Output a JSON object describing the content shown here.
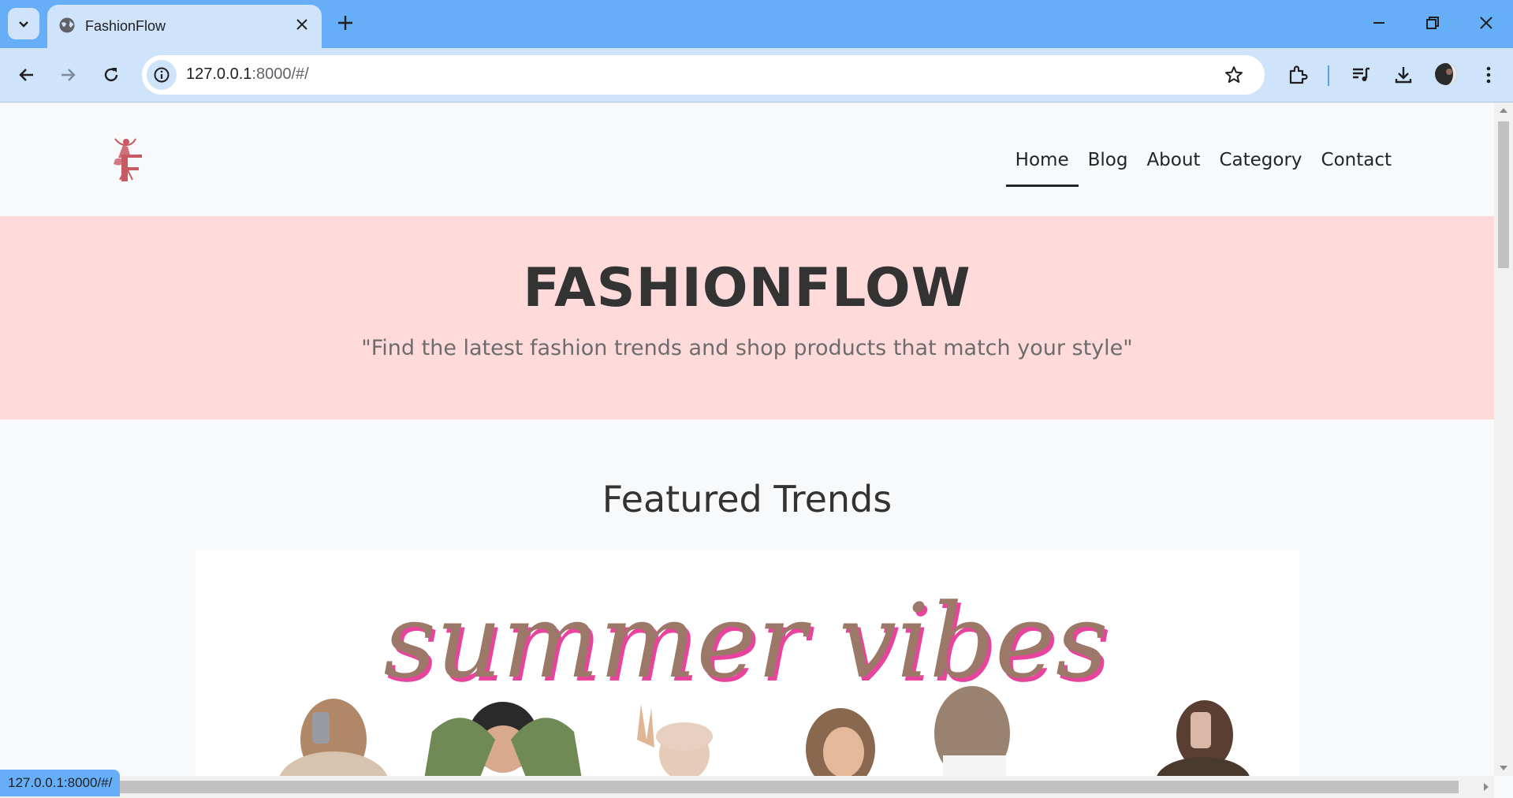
{
  "browser": {
    "tab_title": "FashionFlow",
    "url_host": "127.0.0.1",
    "url_path": ":8000/#/",
    "status_url": "127.0.0.1:8000/#/"
  },
  "site": {
    "logo_text": "FASHIONFLOW",
    "nav": [
      "Home",
      "Blog",
      "About",
      "Category",
      "Contact"
    ],
    "active_nav": "Home",
    "hero_title": "FASHIONFLOW",
    "hero_tagline": "\"Find the latest fashion trends and shop products that match your style\"",
    "section_title": "Featured Trends",
    "banner_text": "summer vibes"
  },
  "colors": {
    "tabbar": "#66aff8",
    "toolbar": "#cfe4fb",
    "hero_bg": "#ffdada",
    "banner_script": "#9c7868",
    "banner_shadow": "#e8449e",
    "logo": "#c75a63"
  }
}
